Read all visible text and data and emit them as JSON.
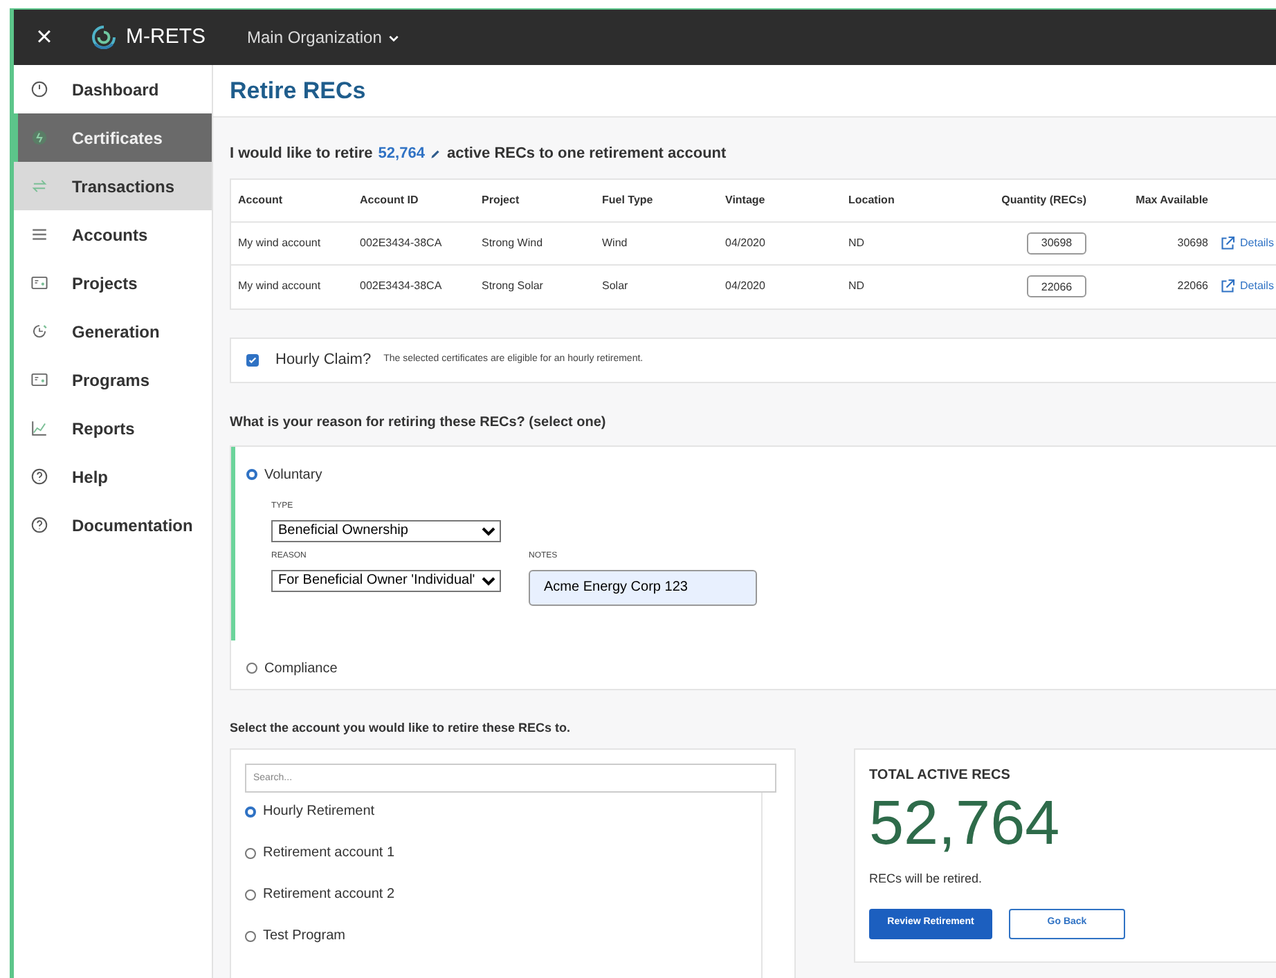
{
  "topbar": {
    "close": "×",
    "brand": "M-RETS",
    "organization": "Main Organization"
  },
  "sidebar": {
    "items": [
      {
        "label": "Dashboard",
        "selected": false,
        "hovered": false
      },
      {
        "label": "Certificates",
        "selected": true,
        "hovered": false
      },
      {
        "label": "Transactions",
        "selected": false,
        "hovered": true
      },
      {
        "label": "Accounts",
        "selected": false,
        "hovered": false
      },
      {
        "label": "Projects",
        "selected": false,
        "hovered": false
      },
      {
        "label": "Generation",
        "selected": false,
        "hovered": false
      },
      {
        "label": "Programs",
        "selected": false,
        "hovered": false
      },
      {
        "label": "Reports",
        "selected": false,
        "hovered": false
      },
      {
        "label": "Help",
        "selected": false,
        "hovered": false
      },
      {
        "label": "Documentation",
        "selected": false,
        "hovered": false
      }
    ]
  },
  "page_title": "Retire RECs",
  "intro": {
    "before": "I would like to retire",
    "amount": "52,764",
    "after": "active RECs to one retirement account"
  },
  "table": {
    "columns": [
      "Account",
      "Account ID",
      "Project",
      "Fuel Type",
      "Vintage",
      "Location",
      "Quantity (RECs)",
      "Max Available"
    ],
    "rows": [
      {
        "account": "My wind account",
        "account_id": "002E3434-38CA",
        "project": "Strong Wind",
        "fuel_type": "Wind",
        "vintage": "04/2020",
        "location": "ND",
        "quantity": "30698",
        "max_available": "30698",
        "link": "Details"
      },
      {
        "account": "My wind account",
        "account_id": "002E3434-38CA",
        "project": "Strong Solar",
        "fuel_type": "Solar",
        "vintage": "04/2020",
        "location": "ND",
        "quantity": "22066",
        "max_available": "22066",
        "link": "Details"
      }
    ]
  },
  "hourly_claim": {
    "checked": true,
    "label": "Hourly Claim?",
    "note": "The selected certificates are eligible for an hourly retirement."
  },
  "reason": {
    "heading": "What is your reason for retiring these RECs? (select one)",
    "options": [
      {
        "label": "Voluntary",
        "selected": true,
        "details": {
          "type_label": "TYPE",
          "type_value": "Beneficial Ownership",
          "reason_label": "REASON",
          "reason_value": "For Beneficial Owner 'Individual'",
          "notes_label": "NOTES",
          "notes_value": "Acme Energy Corp 123"
        }
      },
      {
        "label": "Compliance",
        "selected": false
      }
    ]
  },
  "account_select": {
    "heading": "Select the account you would like to retire these RECs to.",
    "search_placeholder": "Search...",
    "options": [
      {
        "label": "Hourly Retirement",
        "selected": true
      },
      {
        "label": "Retirement account 1",
        "selected": false
      },
      {
        "label": "Retirement account 2",
        "selected": false
      },
      {
        "label": "Test Program",
        "selected": false
      }
    ]
  },
  "summary": {
    "title": "TOTAL ACTIVE RECS",
    "total": "52,764",
    "caption": "RECs will be retired.",
    "buttons": [
      "Review Retirement",
      "Go Back"
    ]
  }
}
